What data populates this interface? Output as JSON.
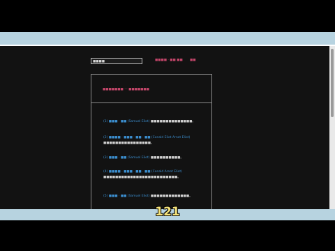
{
  "colors": {
    "page_background": "#121212",
    "stripe": "#b7d3e0",
    "link_red": "#c4466a",
    "reference_blue": "#3c8fd0",
    "text": "#d2d2d2",
    "subtitle": "#f4e27a"
  },
  "toolbar": {
    "search_value": "■■■■",
    "nav_chapter": "■■■■ · ■■ ■■",
    "nav_dir": "■■"
  },
  "title": "■■■■■■■ — ■■■■■■■",
  "paragraphs": [
    {
      "ref": "(1) ■■■ · ■■ (Samuel Eliot)",
      "text": "■■■■■■■■■■■■■■。"
    },
    {
      "ref": "(2) ■■■■ · ■■■ · ■■ · ■■ (Conald Eliot Arnot Eliot)",
      "text": "■■■■■■■■■■■■■■■■。"
    },
    {
      "ref": "(3) ■■■ · ■■ (Samuel Eliot)",
      "text": "■■■■■■■■■■。"
    },
    {
      "ref": "(4) ■■■■ · ■■■ · ■■ · ■■ (Conald Arnot Eliot)",
      "text": "■■■■■■■■■■■■■■■■■■■■■■■■■。"
    },
    {
      "ref": "(5) ■■■ · ■■ (Samuel Eliot)",
      "text": "■■■■■■■■■■■■■。"
    }
  ],
  "subtitle": "121"
}
